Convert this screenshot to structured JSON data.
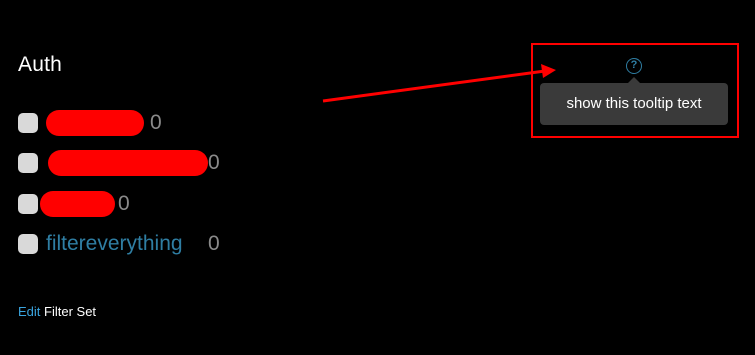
{
  "widget": {
    "title": "Auth"
  },
  "filters": [
    {
      "label": "",
      "count": "0",
      "redacted": true
    },
    {
      "label": "",
      "count": "0",
      "redacted": true
    },
    {
      "label": "",
      "count": "0",
      "redacted": true
    },
    {
      "label": "filtereverything",
      "count": "0",
      "redacted": false
    }
  ],
  "footer": {
    "edit_label": "Edit",
    "filter_set_label": "Filter Set"
  },
  "tooltip": {
    "text": "show this tooltip text",
    "icon": "question-circle-icon"
  },
  "colors": {
    "background": "#000000",
    "annotation_red": "#ff0000",
    "term_link": "#2f7ea3",
    "edit_link": "#3aa4de",
    "tooltip_bg": "#3a3a3a"
  }
}
